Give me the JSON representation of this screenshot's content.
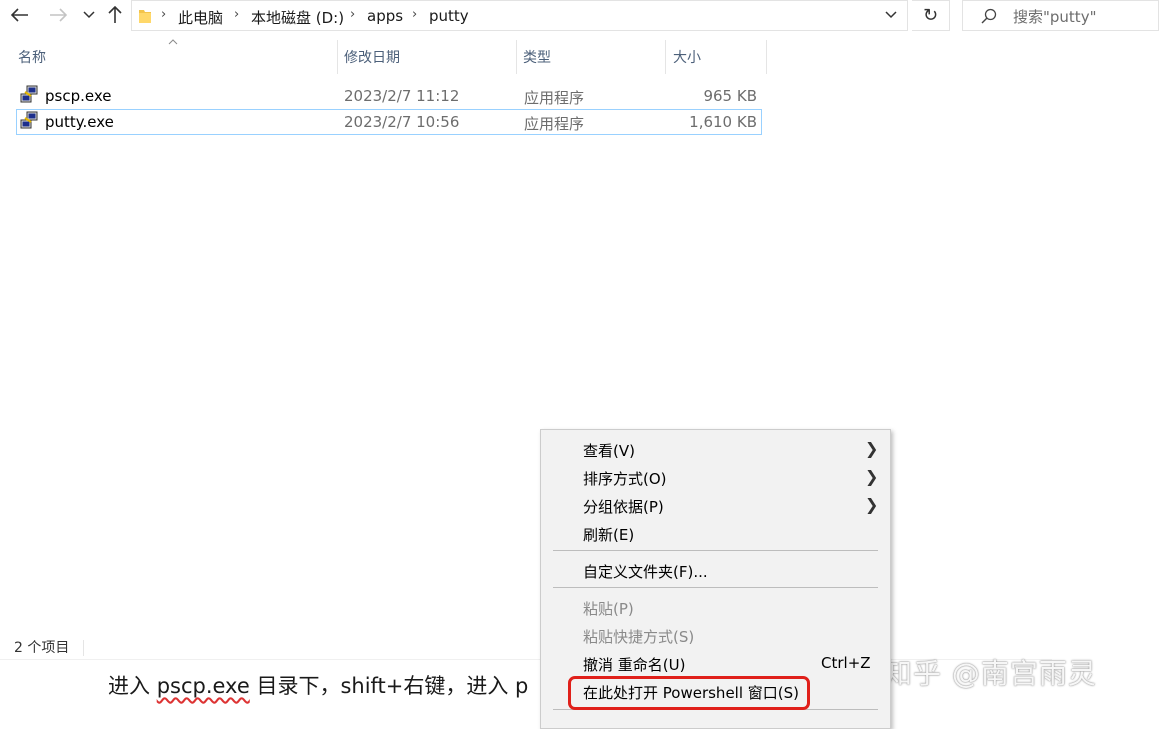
{
  "nav": {
    "back_icon": "arrow-left-icon",
    "forward_icon": "arrow-right-icon",
    "recent_icon": "chevron-down-icon",
    "up_icon": "arrow-up-icon"
  },
  "address": {
    "folder_icon": "folder-icon",
    "breadcrumb": [
      "此电脑",
      "本地磁盘 (D:)",
      "apps",
      "putty"
    ]
  },
  "search": {
    "placeholder": "搜索\"putty\"",
    "icon": "search-icon"
  },
  "columns": {
    "name": "名称",
    "date": "修改日期",
    "type": "类型",
    "size": "大小"
  },
  "files": [
    {
      "name": "pscp.exe",
      "date": "2023/2/7 11:12",
      "type": "应用程序",
      "size": "965 KB",
      "selected": false
    },
    {
      "name": "putty.exe",
      "date": "2023/2/7 10:56",
      "type": "应用程序",
      "size": "1,610 KB",
      "selected": true
    }
  ],
  "status": {
    "count": "2 个项目"
  },
  "context_menu": {
    "items": [
      {
        "label": "查看(V)",
        "submenu": true,
        "enabled": true
      },
      {
        "label": "排序方式(O)",
        "submenu": true,
        "enabled": true
      },
      {
        "label": "分组依据(P)",
        "submenu": true,
        "enabled": true
      },
      {
        "label": "刷新(E)",
        "enabled": true
      },
      {
        "label": "自定义文件夹(F)...",
        "enabled": true
      },
      {
        "label": "粘贴(P)",
        "enabled": false
      },
      {
        "label": "粘贴快捷方式(S)",
        "enabled": false
      },
      {
        "label": "撤消 重命名(U)",
        "shortcut": "Ctrl+Z",
        "enabled": true
      },
      {
        "label": "在此处打开 Powershell 窗口(S)",
        "enabled": true,
        "highlighted": true
      }
    ]
  },
  "caption": {
    "part1": "进入 ",
    "part2": "pscp.exe",
    "part3": " 目录下，shift+右键，进入 p"
  },
  "watermark": "知乎 @南宫雨灵",
  "colors": {
    "highlight_border": "#e0201a",
    "selection_border": "#99d1ff"
  }
}
